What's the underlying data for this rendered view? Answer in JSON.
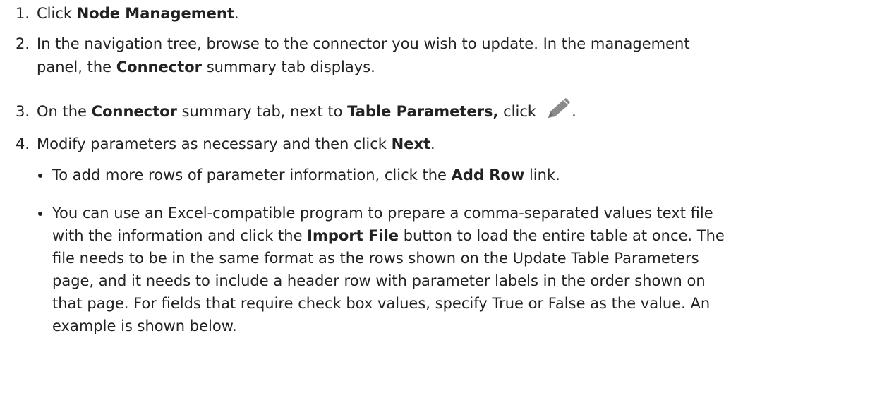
{
  "steps": [
    {
      "number": "1.",
      "text_before": "Click ",
      "bold": "Node Management",
      "text_after": "."
    },
    {
      "number": "2.",
      "line1": "In the navigation tree, browse to the connector you wish to update. In the management",
      "line2_before": "panel, the ",
      "line2_bold": "Connector",
      "line2_after": " summary tab displays."
    },
    {
      "number": "3.",
      "text1": "On the ",
      "bold1": "Connector",
      "text2": " summary tab, next to ",
      "bold2": "Table Parameters,",
      "text3": " click",
      "icon": "pencil-edit-icon",
      "text4": "."
    },
    {
      "number": "4.",
      "text_before": "Modify parameters as necessary and then click ",
      "bold": "Next",
      "text_after": "."
    }
  ],
  "bullets": [
    {
      "text_before": "To add more rows of parameter information, click the ",
      "bold": "Add Row",
      "text_after": " link."
    },
    {
      "line1": "You can use an Excel-compatible program to prepare a comma-separated values text file",
      "line2_before": "with the information and click the ",
      "line2_bold": "Import File",
      "line2_after": " button to load the entire table at once. The",
      "line3": "file needs to be in the same format as the rows shown on the Update Table Parameters",
      "line4": "page, and it needs to include a header row with parameter labels in the order shown on",
      "line5": "that page. For fields that require check box values, specify True or False as the value. An",
      "line6": "example is shown below."
    }
  ],
  "colors": {
    "text": "#222222",
    "icon": "#8a8a8a"
  }
}
